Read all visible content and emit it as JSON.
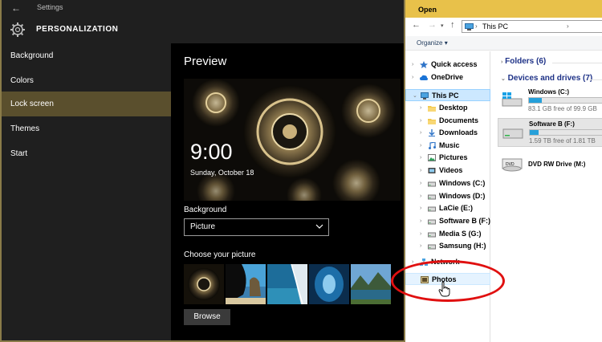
{
  "settings": {
    "title": "Settings",
    "header": "PERSONALIZATION",
    "nav": [
      {
        "label": "Background"
      },
      {
        "label": "Colors"
      },
      {
        "label": "Lock screen"
      },
      {
        "label": "Themes"
      },
      {
        "label": "Start"
      }
    ],
    "active_nav": "Lock screen",
    "preview_title": "Preview",
    "lock_time": "9:00",
    "lock_date": "Sunday, October 18",
    "background_label": "Background",
    "background_value": "Picture",
    "choose_label": "Choose your picture",
    "browse_label": "Browse"
  },
  "dialog": {
    "title": "Open",
    "address": "This PC",
    "organize_label": "Organize",
    "tree": [
      {
        "label": "Quick access",
        "bold": true,
        "indent": 0,
        "icon": "star-icon",
        "expander": true
      },
      {
        "label": "OneDrive",
        "bold": true,
        "indent": 0,
        "icon": "cloud-icon",
        "expander": true
      },
      {
        "label": "This PC",
        "bold": true,
        "indent": 0,
        "icon": "computer-icon",
        "expander": true,
        "expanded": true,
        "selected": true
      },
      {
        "label": "Desktop",
        "bold": true,
        "indent": 1,
        "icon": "folder-icon",
        "expander": true
      },
      {
        "label": "Documents",
        "bold": true,
        "indent": 1,
        "icon": "folder-icon",
        "expander": true
      },
      {
        "label": "Downloads",
        "bold": true,
        "indent": 1,
        "icon": "download-icon",
        "expander": true
      },
      {
        "label": "Music",
        "bold": true,
        "indent": 1,
        "icon": "music-icon",
        "expander": true
      },
      {
        "label": "Pictures",
        "bold": true,
        "indent": 1,
        "icon": "pictures-icon",
        "expander": true
      },
      {
        "label": "Videos",
        "bold": true,
        "indent": 1,
        "icon": "video-icon",
        "expander": true
      },
      {
        "label": "Windows (C:)",
        "bold": true,
        "indent": 1,
        "icon": "drive-icon",
        "expander": true
      },
      {
        "label": "Windows (D:)",
        "bold": true,
        "indent": 1,
        "icon": "drive-icon",
        "expander": true
      },
      {
        "label": "LaCie (E:)",
        "bold": true,
        "indent": 1,
        "icon": "drive-icon",
        "expander": true
      },
      {
        "label": "Software B (F:)",
        "bold": true,
        "indent": 1,
        "icon": "drive-icon",
        "expander": true
      },
      {
        "label": "Media S (G:)",
        "bold": true,
        "indent": 1,
        "icon": "drive-icon",
        "expander": true
      },
      {
        "label": "Samsung (H:)",
        "bold": true,
        "indent": 1,
        "icon": "drive-icon",
        "expander": true
      },
      {
        "label": "Network",
        "bold": true,
        "indent": 0,
        "icon": "network-icon",
        "expander": true
      },
      {
        "label": "Photos",
        "bold": true,
        "indent": 0,
        "icon": "photos-folder-icon",
        "expander": false,
        "hover": true
      }
    ],
    "folders_header": "Folders (6)",
    "devices_header": "Devices and drives (7)",
    "drives": [
      {
        "name": "Windows (C:)",
        "free": "83.1 GB free of 99.9 GB",
        "used_fraction": 0.17,
        "icon": "windows-drive-icon"
      },
      {
        "name": "Software B (F:)",
        "free": "1.59 TB free of 1.81 TB",
        "used_fraction": 0.12,
        "icon": "hard-drive-icon",
        "selected": true
      },
      {
        "name": "DVD RW Drive (M:)",
        "free": "",
        "icon": "dvd-drive-icon"
      }
    ],
    "accent": "#26a0da",
    "title_color": "#e8c14a"
  },
  "annotation_color": "#e01010"
}
